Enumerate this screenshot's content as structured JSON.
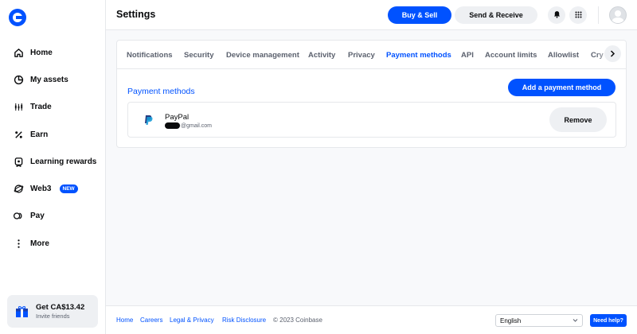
{
  "header": {
    "title": "Settings",
    "buy_sell_label": "Buy & Sell",
    "send_receive_label": "Send & Receive"
  },
  "sidebar": {
    "items": [
      {
        "label": "Home",
        "icon": "home-icon"
      },
      {
        "label": "My assets",
        "icon": "pie-chart-icon"
      },
      {
        "label": "Trade",
        "icon": "candles-icon"
      },
      {
        "label": "Earn",
        "icon": "percent-icon"
      },
      {
        "label": "Learning rewards",
        "icon": "reward-icon"
      },
      {
        "label": "Web3",
        "icon": "web3-icon",
        "badge": "NEW"
      },
      {
        "label": "Pay",
        "icon": "pay-icon"
      },
      {
        "label": "More",
        "icon": "more-icon"
      }
    ],
    "promo": {
      "title": "Get CA$13.42",
      "subtitle": "Invite friends",
      "icon": "gift-icon"
    }
  },
  "tabs": [
    {
      "label": "Notifications",
      "active": false
    },
    {
      "label": "Security",
      "active": false
    },
    {
      "label": "Device management",
      "active": false
    },
    {
      "label": "Activity",
      "active": false
    },
    {
      "label": "Privacy",
      "active": false
    },
    {
      "label": "Payment methods",
      "active": true
    },
    {
      "label": "API",
      "active": false
    },
    {
      "label": "Account limits",
      "active": false
    },
    {
      "label": "Allowlist",
      "active": false
    },
    {
      "label": "Cry",
      "active": false
    }
  ],
  "payment_methods": {
    "section_title": "Payment methods",
    "add_label": "Add a payment method",
    "items": [
      {
        "name": "PayPal",
        "email_suffix": "@gmail.com",
        "remove_label": "Remove",
        "icon": "paypal-icon"
      }
    ]
  },
  "footer": {
    "links": [
      "Home",
      "Careers",
      "Legal & Privacy",
      "Risk Disclosure"
    ],
    "copyright": "© 2023 Coinbase",
    "language": "English",
    "help_label": "Need help?"
  },
  "colors": {
    "brand": "#0052ff",
    "text": "#0a0b0d",
    "muted": "#5b616e",
    "background": "#f8f9fb"
  }
}
